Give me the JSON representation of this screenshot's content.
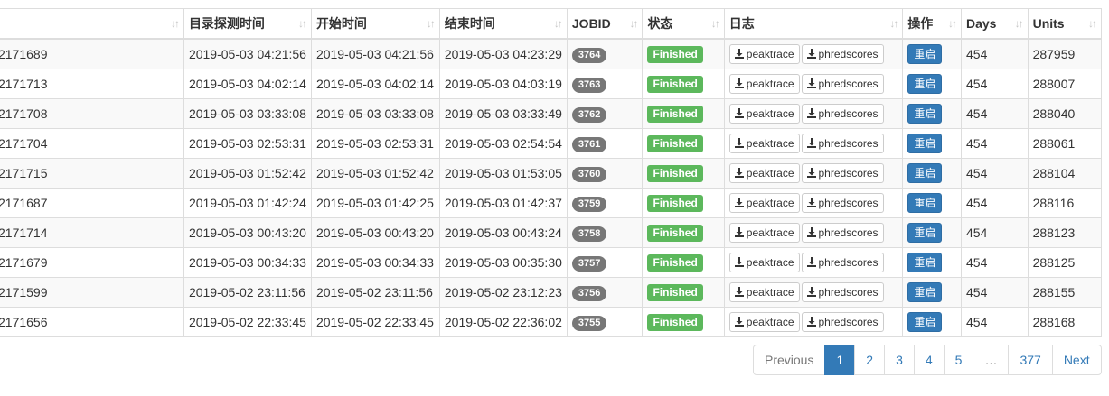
{
  "table": {
    "headers": [
      "",
      "目录探测时间",
      "开始时间",
      "结束时间",
      "JOBID",
      "状态",
      "日志",
      "操作",
      "Days",
      "Units"
    ],
    "sort_glyph": "↓↑",
    "download_labels": [
      "peaktrace",
      "phredscores"
    ],
    "restart_label": "重启",
    "rows": [
      {
        "id": "2171689",
        "detect": "2019-05-03 04:21:56",
        "start": "2019-05-03 04:21:56",
        "end": "2019-05-03 04:23:29",
        "jobid": "3764",
        "status": "Finished",
        "days": "454",
        "units": "287959"
      },
      {
        "id": "2171713",
        "detect": "2019-05-03 04:02:14",
        "start": "2019-05-03 04:02:14",
        "end": "2019-05-03 04:03:19",
        "jobid": "3763",
        "status": "Finished",
        "days": "454",
        "units": "288007"
      },
      {
        "id": "2171708",
        "detect": "2019-05-03 03:33:08",
        "start": "2019-05-03 03:33:08",
        "end": "2019-05-03 03:33:49",
        "jobid": "3762",
        "status": "Finished",
        "days": "454",
        "units": "288040"
      },
      {
        "id": "2171704",
        "detect": "2019-05-03 02:53:31",
        "start": "2019-05-03 02:53:31",
        "end": "2019-05-03 02:54:54",
        "jobid": "3761",
        "status": "Finished",
        "days": "454",
        "units": "288061"
      },
      {
        "id": "2171715",
        "detect": "2019-05-03 01:52:42",
        "start": "2019-05-03 01:52:42",
        "end": "2019-05-03 01:53:05",
        "jobid": "3760",
        "status": "Finished",
        "days": "454",
        "units": "288104"
      },
      {
        "id": "2171687",
        "detect": "2019-05-03 01:42:24",
        "start": "2019-05-03 01:42:25",
        "end": "2019-05-03 01:42:37",
        "jobid": "3759",
        "status": "Finished",
        "days": "454",
        "units": "288116"
      },
      {
        "id": "2171714",
        "detect": "2019-05-03 00:43:20",
        "start": "2019-05-03 00:43:20",
        "end": "2019-05-03 00:43:24",
        "jobid": "3758",
        "status": "Finished",
        "days": "454",
        "units": "288123"
      },
      {
        "id": "2171679",
        "detect": "2019-05-03 00:34:33",
        "start": "2019-05-03 00:34:33",
        "end": "2019-05-03 00:35:30",
        "jobid": "3757",
        "status": "Finished",
        "days": "454",
        "units": "288125"
      },
      {
        "id": "2171599",
        "detect": "2019-05-02 23:11:56",
        "start": "2019-05-02 23:11:56",
        "end": "2019-05-02 23:12:23",
        "jobid": "3756",
        "status": "Finished",
        "days": "454",
        "units": "288155"
      },
      {
        "id": "2171656",
        "detect": "2019-05-02 22:33:45",
        "start": "2019-05-02 22:33:45",
        "end": "2019-05-02 22:36:02",
        "jobid": "3755",
        "status": "Finished",
        "days": "454",
        "units": "288168"
      }
    ]
  },
  "pagination": {
    "previous": "Previous",
    "pages": [
      "1",
      "2",
      "3",
      "4",
      "5",
      "…",
      "377"
    ],
    "active_page": "1",
    "next": "Next"
  },
  "colors": {
    "status_finished": "#5cb85c",
    "jobid_badge": "#777777",
    "primary": "#337ab7"
  },
  "icons": {
    "download": "download-icon",
    "sort": "sort-icon"
  }
}
